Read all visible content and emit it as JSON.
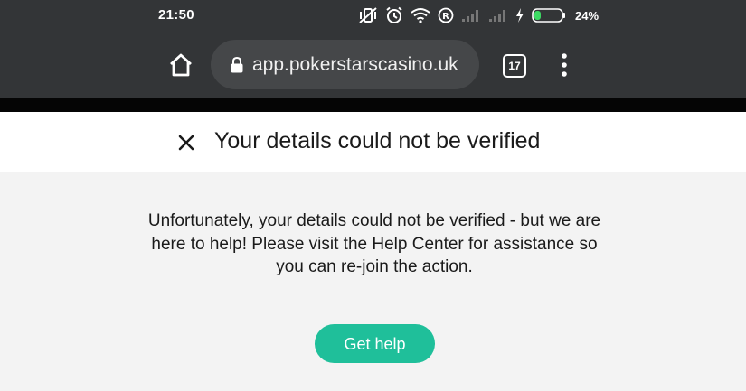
{
  "status_bar": {
    "time": "21:50",
    "battery_percent": "24%",
    "icons": [
      "vibrate-off-icon",
      "alarm-icon",
      "wifi-icon",
      "registered-icon",
      "signal-icon",
      "signal-icon",
      "charging-icon",
      "battery-icon"
    ],
    "battery_level": 0.24,
    "battery_color": "#3ddc64"
  },
  "browser": {
    "url": "app.pokerstarscasino.uk",
    "tab_count": "17",
    "icons": [
      "home-icon",
      "lock-icon",
      "tabs-icon",
      "more-vert-icon"
    ]
  },
  "dialog": {
    "title": "Your details could not be verified",
    "message": "Unfortunately, your details could not be verified - but we are here to help! Please visit the Help Center for assistance so you can re-join the action.",
    "button_label": "Get help",
    "button_color": "#1fbf9a"
  }
}
